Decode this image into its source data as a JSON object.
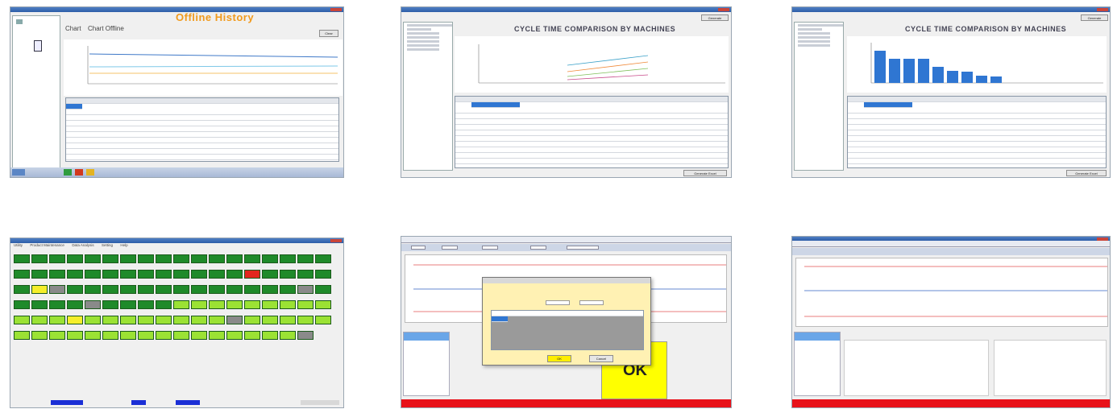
{
  "colors": {
    "titlebar": "#3b6db5",
    "red_status": "#e8121a",
    "yellow_ok": "#ffff00",
    "cell_dark_green": "#1f8a2a",
    "cell_light_green": "#9be234",
    "cell_red": "#e2261e",
    "cell_grey": "#8a8a8a",
    "cell_yellow": "#f5ee2a",
    "bar_blue": "#2f76d2"
  },
  "thumb1": {
    "title": "Offline History",
    "tabs": [
      "Chart",
      "Chart Offline"
    ],
    "button": "Clear"
  },
  "thumb2": {
    "title": "CYCLE TIME COMPARISON BY MACHINES",
    "button_top": "Generate",
    "button_bottom": "Generate Excel"
  },
  "thumb3": {
    "title": "CYCLE TIME COMPARISON BY MACHINES",
    "button_top": "Generate",
    "button_bottom": "Generate Excel"
  },
  "thumb4": {
    "menu": [
      "Utility",
      "Product Maintenance",
      "Data Analysis",
      "Setting",
      "Help"
    ]
  },
  "thumb5": {
    "ok_text": "OK",
    "dialog_ok": "OK",
    "dialog_cancel": "Cancel"
  },
  "thumb6": {}
}
